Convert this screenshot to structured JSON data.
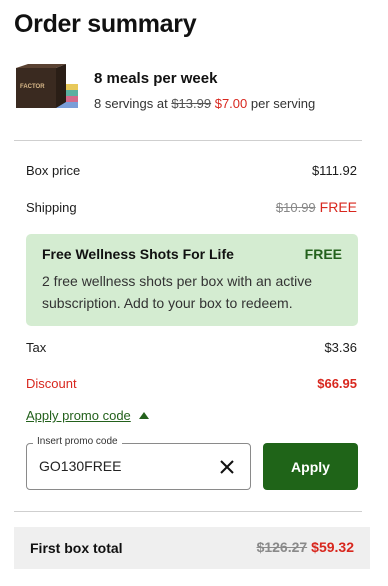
{
  "page": {
    "title": "Order summary"
  },
  "plan": {
    "name": "8 meals per week",
    "servings_prefix": "8 servings at",
    "old_price": "$13.99",
    "new_price": "$7.00",
    "per_serving": "per serving",
    "brand": "FACTOR"
  },
  "lines": {
    "box_price_label": "Box price",
    "box_price_value": "$111.92",
    "shipping_label": "Shipping",
    "shipping_old": "$10.99",
    "shipping_new": "FREE",
    "tax_label": "Tax",
    "tax_value": "$3.36",
    "discount_label": "Discount",
    "discount_value": "$66.95"
  },
  "wellness": {
    "title": "Free Wellness Shots For Life",
    "badge": "FREE",
    "description": "2 free wellness shots per box with an active subscription. Add to your box to redeem."
  },
  "promo": {
    "link_label": "Apply promo code",
    "field_label": "Insert promo code",
    "value": "GO130FREE",
    "apply_label": "Apply"
  },
  "total": {
    "label": "First box total",
    "old": "$126.27",
    "new": "$59.32"
  },
  "colors": {
    "accent_green": "#1f6418",
    "sale_red": "#d8271e",
    "promo_bg": "#d4ecd1"
  }
}
